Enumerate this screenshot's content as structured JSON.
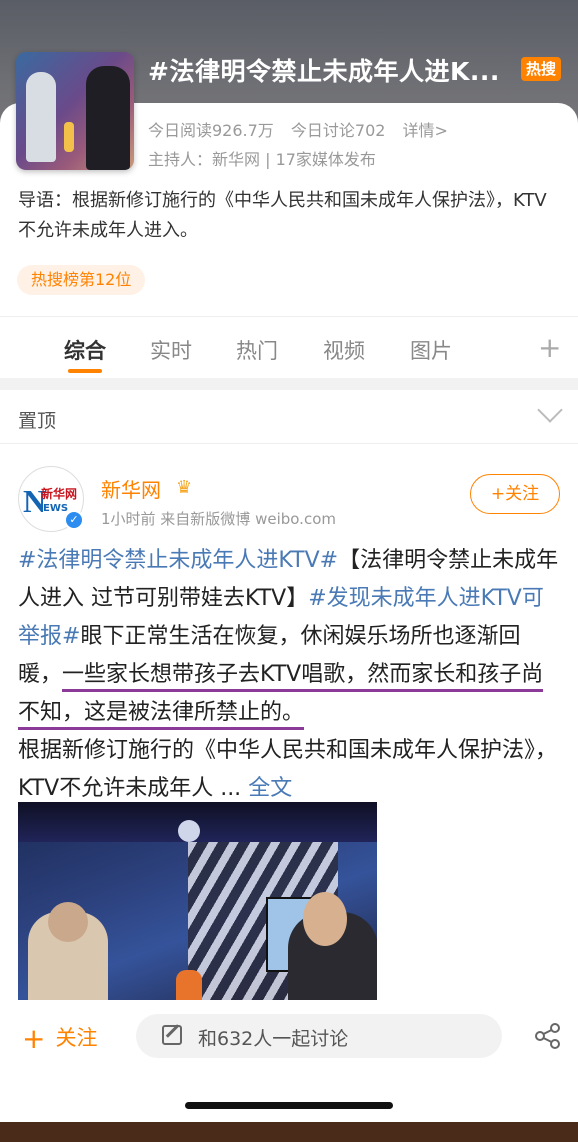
{
  "topic": {
    "title": "#法律明令禁止未成年人进K...",
    "hot_badge": "热搜",
    "reads": "今日阅读926.7万",
    "discussions": "今日讨论702",
    "details_link": "详情>",
    "host_line": "主持人：新华网 | 17家媒体发布",
    "guide_text": "导语：根据新修订施行的《中华人民共和国未成年人保护法》，KTV不允许未成年人进入。",
    "rank_badge": "热搜榜第12位"
  },
  "tabs": [
    {
      "label": "综合"
    },
    {
      "label": "实时"
    },
    {
      "label": "热门"
    },
    {
      "label": "视频"
    },
    {
      "label": "图片"
    }
  ],
  "tab_add": "+",
  "pinned": {
    "label": "置顶"
  },
  "post": {
    "author": "新华网",
    "meta": "1小时前 来自新版微博 weibo.com",
    "follow_label": "+关注",
    "avatar_text": {
      "n": "N",
      "cn": "新华网",
      "ews": "EWS"
    },
    "body": {
      "tag1": "#法律明令禁止未成年人进KTV#",
      "t1": "【法律明令禁止未成年人进入 过节可别带娃去KTV】",
      "tag2": "#发现未成年人进KTV可举报#",
      "t2": "眼下正常生活在恢复，休闲娱乐场所也逐渐回暖，",
      "highlight": "一些家长想带孩子去KTV唱歌，然而家长和孩子尚不知，这是被法律所禁止的。",
      "t3": "根据新修订施行的《中华人民共和国未成年人保护法》，KTV不允许未成年人 ...",
      "more": "全文"
    }
  },
  "bottom": {
    "follow_label": "关注",
    "discuss_placeholder": "和632人一起讨论"
  },
  "colors": {
    "accent": "#ff8200",
    "link": "#4a7ab5",
    "highlight_underline": "#8b3a9a"
  }
}
